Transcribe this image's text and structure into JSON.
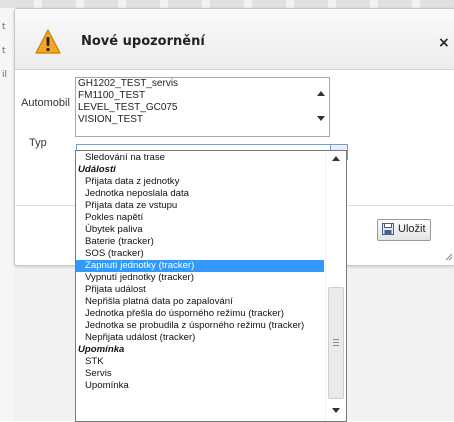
{
  "background": {
    "left_letters": [
      "t",
      "t",
      "il"
    ]
  },
  "dialog": {
    "title": "Nové upozornění",
    "close_label": "×",
    "vehicle_label": "Automobil",
    "vehicles": [
      "GH1202_TEST_servis",
      "FM1100_TEST",
      "LEVEL_TEST_GC075",
      "VISION_TEST"
    ],
    "type_label": "Typ",
    "type_value": "---",
    "save_label": "Uložit"
  },
  "dropdown": {
    "items": [
      {
        "label": "Sledování na trase",
        "kind": "item"
      },
      {
        "label": "Události",
        "kind": "group"
      },
      {
        "label": "Přijata data z jednotky",
        "kind": "item"
      },
      {
        "label": "Jednotka neposlala data",
        "kind": "item"
      },
      {
        "label": "Přijata data ze vstupu",
        "kind": "item"
      },
      {
        "label": "Pokles napětí",
        "kind": "item"
      },
      {
        "label": "Úbytek paliva",
        "kind": "item"
      },
      {
        "label": "Baterie (tracker)",
        "kind": "item"
      },
      {
        "label": "SOS (tracker)",
        "kind": "item"
      },
      {
        "label": "Zapnutí jednotky (tracker)",
        "kind": "selected"
      },
      {
        "label": "Vypnutí jednotky (tracker)",
        "kind": "item"
      },
      {
        "label": "Přijata událost",
        "kind": "item"
      },
      {
        "label": "Nepřišla platná data po zapalování",
        "kind": "item"
      },
      {
        "label": "Jednotka přešla do úsporného režimu (tracker)",
        "kind": "item"
      },
      {
        "label": "Jednotka se probudila z úsporného režimu (tracker)",
        "kind": "item"
      },
      {
        "label": "Nepřijata událost (tracker)",
        "kind": "item"
      },
      {
        "label": "Upomínka",
        "kind": "group"
      },
      {
        "label": "STK",
        "kind": "item"
      },
      {
        "label": "Servis",
        "kind": "item"
      },
      {
        "label": "Upomínka",
        "kind": "item"
      }
    ]
  },
  "colors": {
    "selected_bg": "#3399ff",
    "warning": "#f5a623"
  }
}
